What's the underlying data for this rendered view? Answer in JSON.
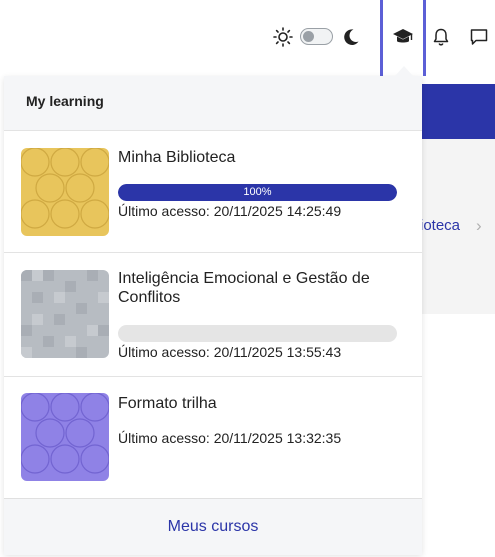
{
  "header": {
    "theme_toggle_state": "light",
    "icons": [
      "sun-icon",
      "moon-icon",
      "graduation-cap-icon",
      "bell-icon",
      "chat-icon"
    ]
  },
  "background": {
    "library_link_partial": "ioteca",
    "accent_color": "#2b35a8"
  },
  "learning_menu": {
    "title": "My learning",
    "footer_link": "Meus cursos",
    "courses": [
      {
        "title": "Minha Biblioteca",
        "progress": 1.0,
        "progress_label": "100%",
        "last_access": "Último acesso: 20/11/2025 14:25:49",
        "thumb_color": "#e8c55c"
      },
      {
        "title": "Inteligência Emocional e Gestão de Conflitos",
        "progress": 0.0,
        "progress_label": "",
        "last_access": "Último acesso: 20/11/2025 13:55:43",
        "thumb_color": "#b7bcc2"
      },
      {
        "title": "Formato trilha",
        "last_access": "Último acesso: 20/11/2025 13:32:35",
        "thumb_color": "#8f82e6"
      }
    ]
  }
}
